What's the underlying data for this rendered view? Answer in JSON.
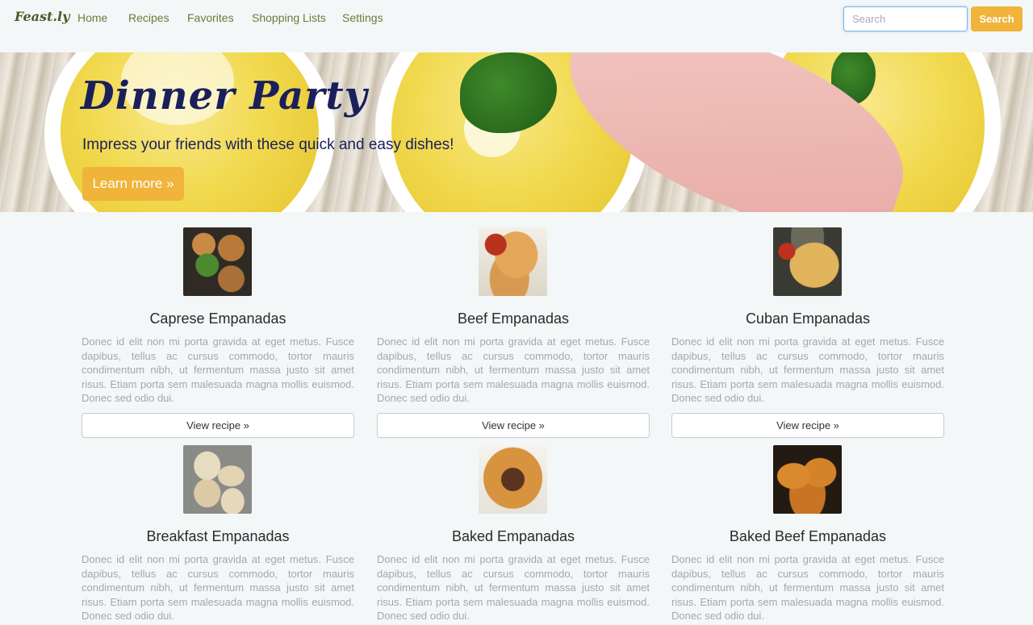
{
  "navbar": {
    "brand": "Feast.ly",
    "links": [
      {
        "label": "Home"
      },
      {
        "label": "Recipes"
      },
      {
        "label": "Favorites"
      },
      {
        "label": "Shopping Lists"
      },
      {
        "label": "Settings"
      }
    ],
    "search": {
      "placeholder": "Search",
      "value": "",
      "button_label": "Search"
    }
  },
  "hero": {
    "title": "Dinner Party",
    "subtitle": "Impress your friends with these quick and easy dishes!",
    "button_label": "Learn more »"
  },
  "recipes": [
    {
      "title": "Caprese Empanadas",
      "description": "Donec id elit non mi porta gravida at eget metus. Fusce dapibus, tellus ac cursus commodo, tortor mauris condimentum nibh, ut fermentum massa justo sit amet risus. Etiam porta sem malesuada magna mollis euismod. Donec sed odio dui.",
      "button_label": "View recipe »"
    },
    {
      "title": "Beef Empanadas",
      "description": "Donec id elit non mi porta gravida at eget metus. Fusce dapibus, tellus ac cursus commodo, tortor mauris condimentum nibh, ut fermentum massa justo sit amet risus. Etiam porta sem malesuada magna mollis euismod. Donec sed odio dui.",
      "button_label": "View recipe »"
    },
    {
      "title": "Cuban Empanadas",
      "description": "Donec id elit non mi porta gravida at eget metus. Fusce dapibus, tellus ac cursus commodo, tortor mauris condimentum nibh, ut fermentum massa justo sit amet risus. Etiam porta sem malesuada magna mollis euismod. Donec sed odio dui.",
      "button_label": "View recipe »"
    },
    {
      "title": "Breakfast Empanadas",
      "description": "Donec id elit non mi porta gravida at eget metus. Fusce dapibus, tellus ac cursus commodo, tortor mauris condimentum nibh, ut fermentum massa justo sit amet risus. Etiam porta sem malesuada magna mollis euismod. Donec sed odio dui."
    },
    {
      "title": "Baked Empanadas",
      "description": "Donec id elit non mi porta gravida at eget metus. Fusce dapibus, tellus ac cursus commodo, tortor mauris condimentum nibh, ut fermentum massa justo sit amet risus. Etiam porta sem malesuada magna mollis euismod. Donec sed odio dui."
    },
    {
      "title": "Baked Beef Empanadas",
      "description": "Donec id elit non mi porta gravida at eget metus. Fusce dapibus, tellus ac cursus commodo, tortor mauris condimentum nibh, ut fermentum massa justo sit amet risus. Etiam porta sem malesuada magna mollis euismod. Donec sed odio dui."
    }
  ],
  "colors": {
    "accent": "#f0b43a",
    "hero_text": "#1a1f5c",
    "nav_link": "#6b7a3a",
    "body_text_muted": "#a3a8ac",
    "page_background": "#f4f7f8"
  }
}
